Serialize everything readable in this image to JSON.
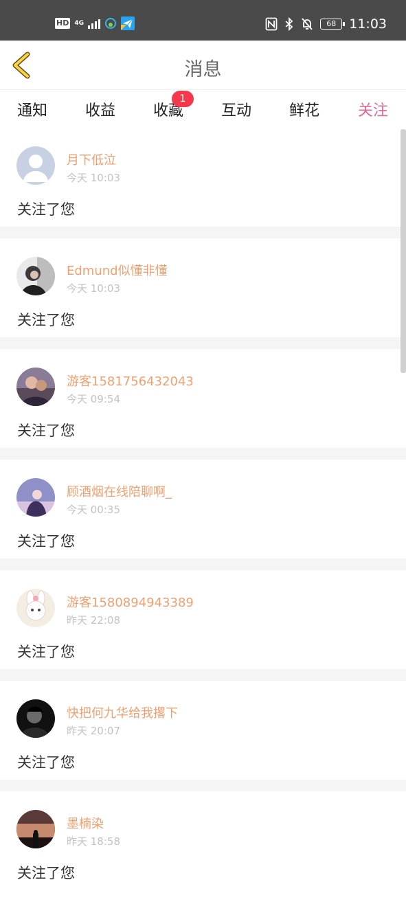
{
  "status": {
    "left": {
      "hd": "HD",
      "net": "4G"
    },
    "battery": "68",
    "time": "11:03"
  },
  "header": {
    "title": "消息",
    "back_icon": "chevron-left-icon"
  },
  "tabs": [
    {
      "label": "通知",
      "active": false
    },
    {
      "label": "收益",
      "active": false
    },
    {
      "label": "收藏",
      "active": false,
      "badge": "1"
    },
    {
      "label": "互动",
      "active": false
    },
    {
      "label": "鲜花",
      "active": false
    },
    {
      "label": "关注",
      "active": true
    }
  ],
  "accent_color": "#e0669a",
  "items": [
    {
      "name": "月下低泣",
      "time": "今天 10:03",
      "text": "关注了您",
      "avatar": "default-avatar"
    },
    {
      "name": "Edmund似懂非懂",
      "time": "今天 10:03",
      "text": "关注了您",
      "avatar": "photo-avatar"
    },
    {
      "name": "游客1581756432043",
      "time": "今天 09:54",
      "text": "关注了您",
      "avatar": "photo-avatar"
    },
    {
      "name": "顾酒烟在线陪聊啊_",
      "time": "今天 00:35",
      "text": "关注了您",
      "avatar": "photo-avatar"
    },
    {
      "name": "游客1580894943389",
      "time": "昨天 22:08",
      "text": "关注了您",
      "avatar": "photo-avatar"
    },
    {
      "name": "快把何九华给我撂下",
      "time": "昨天 20:07",
      "text": "关注了您",
      "avatar": "photo-avatar"
    },
    {
      "name": "墨楠染",
      "time": "昨天 18:58",
      "text": "关注了您",
      "avatar": "photo-avatar"
    }
  ]
}
